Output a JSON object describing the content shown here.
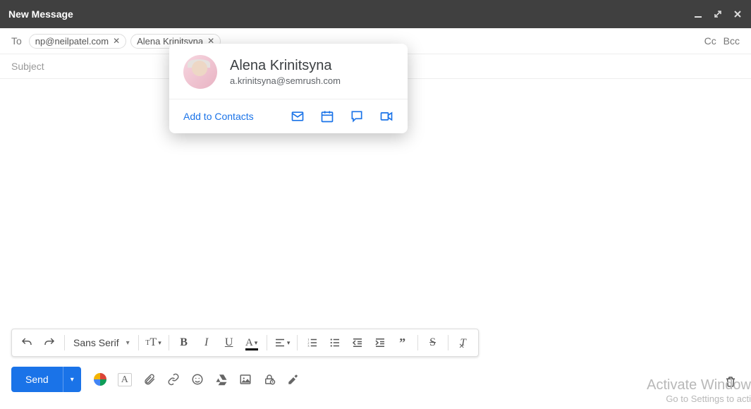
{
  "window": {
    "title": "New Message"
  },
  "to": {
    "label": "To",
    "chips": [
      {
        "text": "np@neilpatel.com"
      },
      {
        "text": "Alena Krinitsyna"
      }
    ],
    "cc": "Cc",
    "bcc": "Bcc"
  },
  "subject": {
    "placeholder": "Subject",
    "value": ""
  },
  "hovercard": {
    "name": "Alena Krinitsyna",
    "email": "a.krinitsyna@semrush.com",
    "add": "Add to Contacts"
  },
  "format": {
    "font": "Sans Serif"
  },
  "send": {
    "label": "Send"
  },
  "watermark": {
    "line1": "Activate Window",
    "line2": "Go to Settings to acti"
  }
}
